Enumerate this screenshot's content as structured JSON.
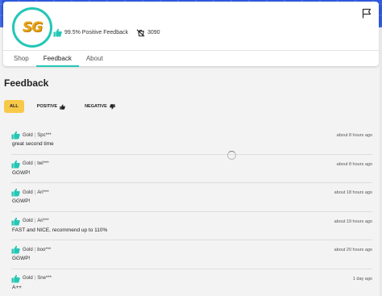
{
  "seller": {
    "avatar_text": "SG",
    "positive_feedback": "99.5% Positive Feedback",
    "sales_count": "3090"
  },
  "tabs": [
    {
      "label": "Shop",
      "active": false
    },
    {
      "label": "Feedback",
      "active": true
    },
    {
      "label": "About",
      "active": false
    }
  ],
  "section_title": "Feedback",
  "filters": {
    "all": "ALL",
    "positive": "POSITIVE",
    "negative": "NEGATIVE"
  },
  "feedback": [
    {
      "product": "Gold",
      "user": "Spc***",
      "time": "about 8 hours ago",
      "comment": "great second time"
    },
    {
      "product": "Gold",
      "user": "twi***",
      "time": "about 8 hours ago",
      "comment": "GGWP!"
    },
    {
      "product": "Gold",
      "user": "Ari***",
      "time": "about 18 hours ago",
      "comment": "GGWP!"
    },
    {
      "product": "Gold",
      "user": "Ari***",
      "time": "about 19 hours ago",
      "comment": "FAST and NICE, recommend up to 110%"
    },
    {
      "product": "Gold",
      "user": "boo***",
      "time": "about 20 hours ago",
      "comment": "GGWP!"
    },
    {
      "product": "Gold",
      "user": "Sne***",
      "time": "1 day ago",
      "comment": "A++"
    }
  ],
  "colors": {
    "accent": "#23c7b6",
    "active_filter": "#f7c948",
    "banner": "#2f5ae0"
  }
}
